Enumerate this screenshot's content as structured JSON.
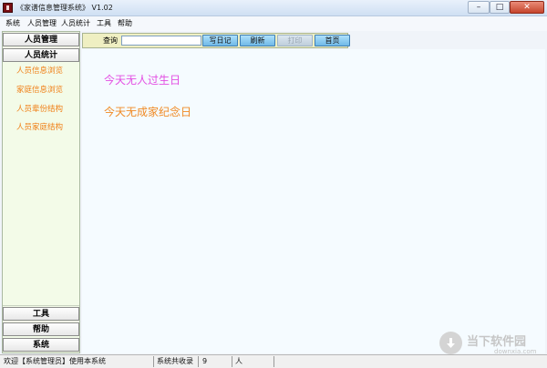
{
  "window": {
    "title": "《家谱信息管理系统》 V1.02",
    "controls": {
      "minimize": "–",
      "maximize": "□",
      "close": "✕"
    }
  },
  "menu": [
    "系统",
    "人员管理",
    "人员统计",
    "工具",
    "帮助"
  ],
  "sidebar": {
    "top_sections": [
      "人员管理",
      "人员统计"
    ],
    "links": [
      "人员信息浏览",
      "家庭信息浏览",
      "人员辈份结构",
      "人员家庭结构"
    ],
    "bottom_sections": [
      "工具",
      "帮助",
      "系统"
    ]
  },
  "toolbar": {
    "query_label": "查询",
    "search_value": "",
    "buttons": [
      "写日记",
      "刷新",
      "打印",
      "首页"
    ]
  },
  "main": {
    "birthday_message": "今天无人过生日",
    "anniversary_message": "今天无成家纪念日"
  },
  "status": {
    "welcome": "欢迎【系统管理员】使用本系统",
    "total_label": "系统共收录",
    "count": "9",
    "unit": "人"
  },
  "watermark": {
    "text": "当下软件园",
    "domain": "downxia.com"
  },
  "colors": {
    "sidebar_bg": "#f3fbe8",
    "link": "#f07e14",
    "birthday": "#e34ee3",
    "anniversary": "#f08a24",
    "toolbar_button": "#6fb9e7"
  }
}
